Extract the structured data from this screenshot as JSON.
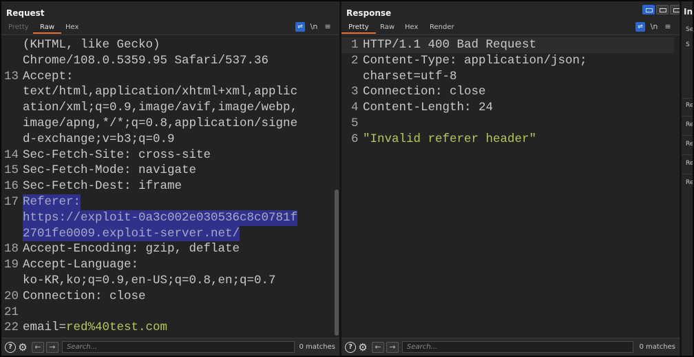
{
  "request": {
    "title": "Request",
    "tabs": [
      {
        "label": "Pretty",
        "state": "disabled"
      },
      {
        "label": "Raw",
        "state": "active"
      },
      {
        "label": "Hex",
        "state": "normal"
      }
    ],
    "lines": [
      {
        "n": "",
        "text": "(KHTML, like Gecko)"
      },
      {
        "n": "",
        "text": "Chrome/108.0.5359.95 Safari/537.36"
      },
      {
        "n": "13",
        "text": "Accept:"
      },
      {
        "n": "",
        "text": "text/html,application/xhtml+xml,applic"
      },
      {
        "n": "",
        "text": "ation/xml;q=0.9,image/avif,image/webp,"
      },
      {
        "n": "",
        "text": "image/apng,*/*;q=0.8,application/signe"
      },
      {
        "n": "",
        "text": "d-exchange;v=b3;q=0.9"
      },
      {
        "n": "14",
        "text": "Sec-Fetch-Site: cross-site"
      },
      {
        "n": "15",
        "text": "Sec-Fetch-Mode: navigate"
      },
      {
        "n": "16",
        "text": "Sec-Fetch-Dest: iframe"
      },
      {
        "n": "17",
        "text": "Referer:"
      },
      {
        "n": "",
        "text": "https://exploit-0a3c002e030536c8c0781f"
      },
      {
        "n": "",
        "text": "2701fe0009.exploit-server.net/"
      },
      {
        "n": "18",
        "text": "Accept-Encoding: gzip, deflate"
      },
      {
        "n": "19",
        "text": "Accept-Language:"
      },
      {
        "n": "",
        "text": "ko-KR,ko;q=0.9,en-US;q=0.8,en;q=0.7"
      },
      {
        "n": "20",
        "text": "Connection: close"
      },
      {
        "n": "21",
        "text": ""
      },
      {
        "n": "22",
        "text_key": "email=",
        "text_val": "red%40test.com"
      }
    ],
    "search_placeholder": "Search...",
    "matches": "0 matches"
  },
  "response": {
    "title": "Response",
    "tabs": [
      {
        "label": "Pretty",
        "state": "active"
      },
      {
        "label": "Raw",
        "state": "normal"
      },
      {
        "label": "Hex",
        "state": "normal"
      },
      {
        "label": "Render",
        "state": "normal"
      }
    ],
    "lines": [
      {
        "n": "1",
        "text": "HTTP/1.1 400 Bad Request"
      },
      {
        "n": "2",
        "text": "Content-Type: application/json;"
      },
      {
        "n": "",
        "text": "charset=utf-8"
      },
      {
        "n": "3",
        "text": "Connection: close"
      },
      {
        "n": "4",
        "text": "Content-Length: 24"
      },
      {
        "n": "5",
        "text": ""
      },
      {
        "n": "6",
        "text": "\"Invalid referer header\""
      }
    ],
    "search_placeholder": "Search...",
    "matches": "0 matches"
  },
  "side": {
    "title": "In",
    "items": [
      "Se",
      "S",
      "Re",
      "Re",
      "Re",
      "Re",
      "Re"
    ]
  },
  "icons": {
    "wrap": "word-wrap-icon",
    "newline": "show-newlines-icon",
    "menu": "menu-icon",
    "help": "help-icon",
    "settings": "gear-icon",
    "back": "arrow-left-icon",
    "forward": "arrow-right-icon"
  },
  "colors": {
    "highlight": "#30318a",
    "accent": "#e8732c",
    "active_button": "#2c66c8",
    "string": "#b7c75c"
  }
}
